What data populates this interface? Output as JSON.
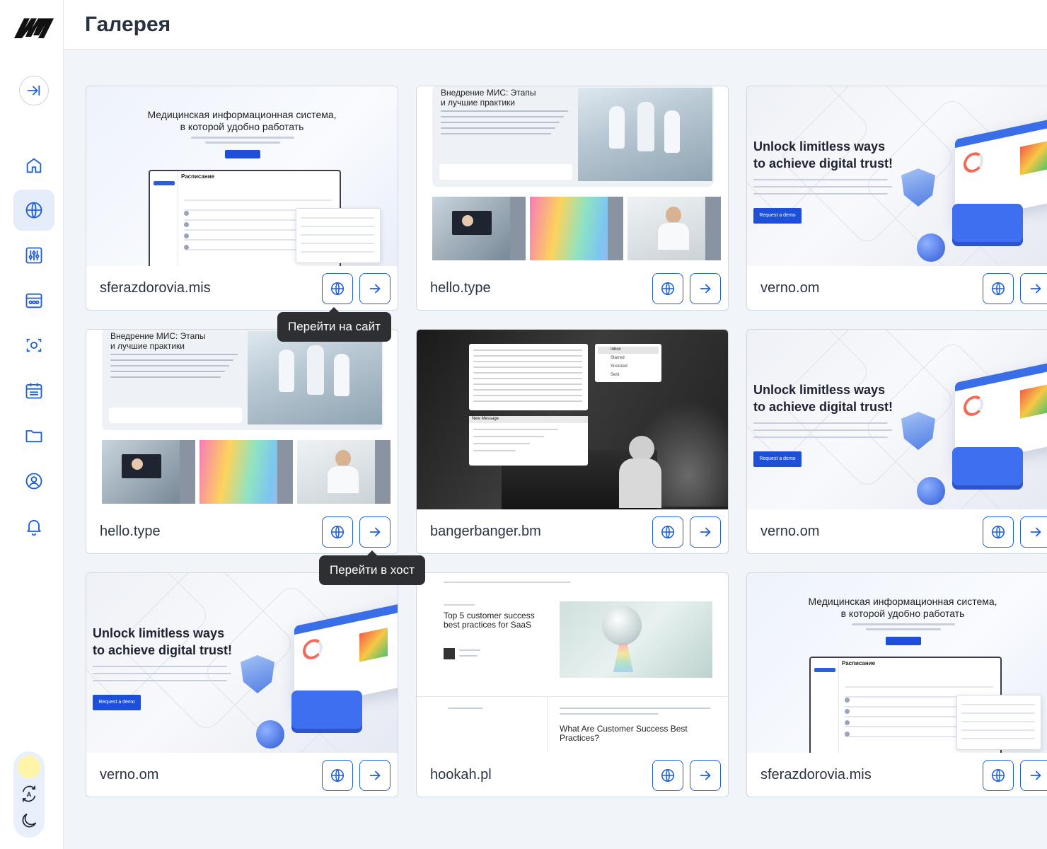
{
  "header": {
    "title": "Галерея"
  },
  "sidebar": {
    "logo": "brand-logo",
    "collapse_icon": "collapse-arrow-icon",
    "items": [
      {
        "name": "home",
        "icon": "home-icon"
      },
      {
        "name": "sites",
        "icon": "globe-icon",
        "active": true
      },
      {
        "name": "settings",
        "icon": "sliders-icon"
      },
      {
        "name": "tools",
        "icon": "control-panel-icon"
      },
      {
        "name": "capture",
        "icon": "scan-icon"
      },
      {
        "name": "calendar",
        "icon": "calendar-icon"
      },
      {
        "name": "files",
        "icon": "folder-icon"
      },
      {
        "name": "profile",
        "icon": "user-circle-icon"
      },
      {
        "name": "notifications",
        "icon": "bell-icon"
      }
    ]
  },
  "cards": [
    {
      "name": "sferazdorovia.mis",
      "preview": "mis"
    },
    {
      "name": "hello.type",
      "preview": "hello"
    },
    {
      "name": "verno.om",
      "preview": "verno"
    },
    {
      "name": "hello.type",
      "preview": "hello"
    },
    {
      "name": "bangerbanger.bm",
      "preview": "banger"
    },
    {
      "name": "verno.om",
      "preview": "verno"
    },
    {
      "name": "verno.om",
      "preview": "verno"
    },
    {
      "name": "hookah.pl",
      "preview": "hookah"
    },
    {
      "name": "sferazdorovia.mis",
      "preview": "mis"
    }
  ],
  "tooltips": {
    "site": "Перейти на сайт",
    "host": "Перейти в хост"
  },
  "previews": {
    "mis": {
      "headline_1": "Медицинская информационная система,",
      "headline_2": "в которой удобно работать",
      "schedule_title": "Расписание"
    },
    "hello": {
      "headline_1": "Внедрение МИС: Этапы",
      "headline_2": "и лучшие практики"
    },
    "verno": {
      "headline_1": "Unlock limitless ways",
      "headline_2": "to achieve digital trust!",
      "cta": "Request a demo"
    },
    "banger": {
      "inbox": "Inbox",
      "starred": "Starred",
      "snoozed": "Snoozed",
      "sent": "Sent",
      "new_message": "New Message"
    },
    "hookah": {
      "headline": "Top 5 customer success best practices for SaaS",
      "subheading": "What Are Customer Success Best Practices?"
    }
  },
  "colors": {
    "accent": "#1f5fdb",
    "active_nav": "#e6edfa",
    "tooltip": "#2d2f33"
  }
}
